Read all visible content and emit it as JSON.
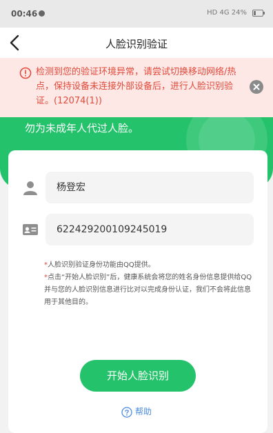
{
  "status_bar": {
    "time": "00:46",
    "indicators": "HD 4G 24%",
    "battery_level": 0.24
  },
  "nav": {
    "title": "人脸识别验证",
    "back_icon": "back-arrow-icon"
  },
  "error": {
    "message": "检测到您的验证环境异常，请尝试切换移动网络/热点，保持设备未连接外部设备后，进行人脸识别验证。(12074(1))",
    "color": "#e24a3b",
    "background": "#fde8e6"
  },
  "hero": {
    "text": "勿为未成年人代过人脸。",
    "color": "#24c26a"
  },
  "form": {
    "name_value": "杨登宏",
    "id_value": "622429200109245019"
  },
  "notes": [
    {
      "mark": "*",
      "text": "人脸识别验证身份功能由QQ提供。"
    },
    {
      "mark": "*",
      "text": "点击“开始人脸识别”后，健康系统会将您的姓名身份信息提供给QQ并与您的人脸识别信息进行比对以完成身份认证，我们不会将此信息用于其他目的。"
    }
  ],
  "actions": {
    "start_label": "开始人脸识别",
    "help_label": "帮助"
  }
}
